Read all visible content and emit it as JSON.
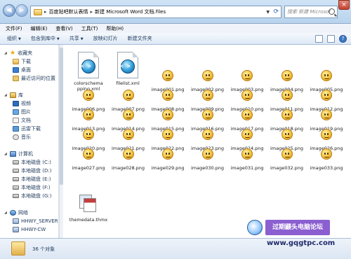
{
  "address": {
    "crumbs": [
      "百度贴吧默认表情",
      "新建 Microsoft Word 文档.files"
    ],
    "search_placeholder": "搜索 新建 Microsoft Word 文档.files"
  },
  "menu": [
    "文件(F)",
    "编辑(E)",
    "查看(V)",
    "工具(T)",
    "帮助(H)"
  ],
  "toolbar": {
    "organize": "组织",
    "include": "包含到库中",
    "share": "共享",
    "slideshow": "放映幻灯片",
    "new_folder": "新建文件夹",
    "help": "?"
  },
  "nav": {
    "favorites": "收藏夹",
    "downloads": "下载",
    "desktop": "桌面",
    "recent": "最近访问的位置",
    "libraries": "库",
    "videos": "视频",
    "pictures": "图片",
    "documents": "文档",
    "thunder": "迅雷下载",
    "music": "音乐",
    "computer": "计算机",
    "drive_c": "本地磁盘 (C:)",
    "drive_d": "本地磁盘 (D:)",
    "drive_e": "本地磁盘 (E:)",
    "drive_f": "本地磁盘 (F:)",
    "drive_g": "本地磁盘 (G:)",
    "network": "网络",
    "host1": "HHWY_SERVER",
    "host2": "HHWY-CW"
  },
  "files": [
    "colorschememapping.xml",
    "filelist.xml",
    "image001.png",
    "image002.png",
    "image003.png",
    "image004.png",
    "image005.png",
    "image006.png",
    "image007.png",
    "image008.png",
    "image009.png",
    "image010.png",
    "image011.png",
    "image012.png",
    "image013.png",
    "image014.png",
    "image015.png",
    "image016.png",
    "image017.png",
    "image018.png",
    "image019.png",
    "image020.png",
    "image021.png",
    "image022.png",
    "image023.png",
    "image024.png",
    "image025.png",
    "image026.png",
    "image027.png",
    "image028.png",
    "image029.png",
    "image030.png",
    "image031.png",
    "image032.png",
    "image033.png",
    "themedata.thmx"
  ],
  "xml_names": [
    "colorschema",
    "pping.xml"
  ],
  "status": "36 个对象",
  "watermark": {
    "title": "过期鼹头电脑论坛",
    "url": "www.gqgtpc.com"
  }
}
